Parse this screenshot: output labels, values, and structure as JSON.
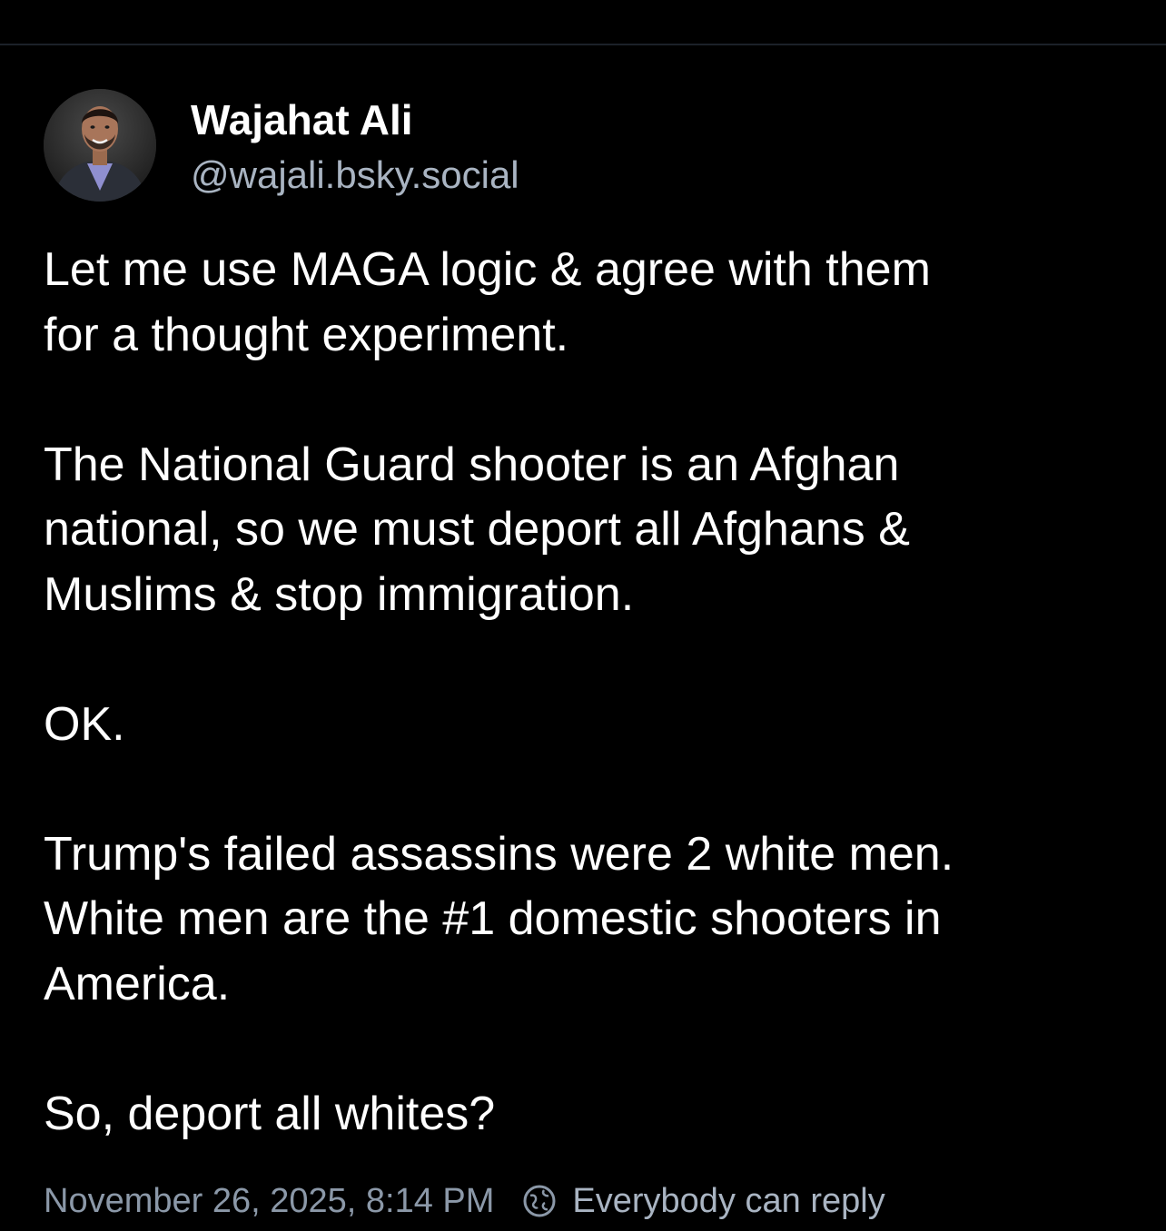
{
  "post": {
    "author": {
      "display_name": "Wajahat Ali",
      "handle": "@wajali.bsky.social",
      "avatar": "profile-photo"
    },
    "paragraphs": [
      "Let me use MAGA logic & agree with them\nfor a thought experiment.",
      "The National Guard shooter is an Afghan\nnational, so we must deport all Afghans &\nMuslims & stop immigration.",
      "OK.",
      "Trump's failed assassins were 2 white men.\nWhite men are the #1 domestic shooters in\nAmerica.",
      "So, deport all whites?"
    ],
    "timestamp": "November 26, 2025, 8:14 PM",
    "reply_setting": {
      "icon": "globe-icon",
      "label": "Everybody can reply"
    }
  },
  "colors": {
    "background": "#000000",
    "text": "#ffffff",
    "handle": "#a9b4c2",
    "meta": "#8b98a8",
    "divider": "#1c2129"
  }
}
